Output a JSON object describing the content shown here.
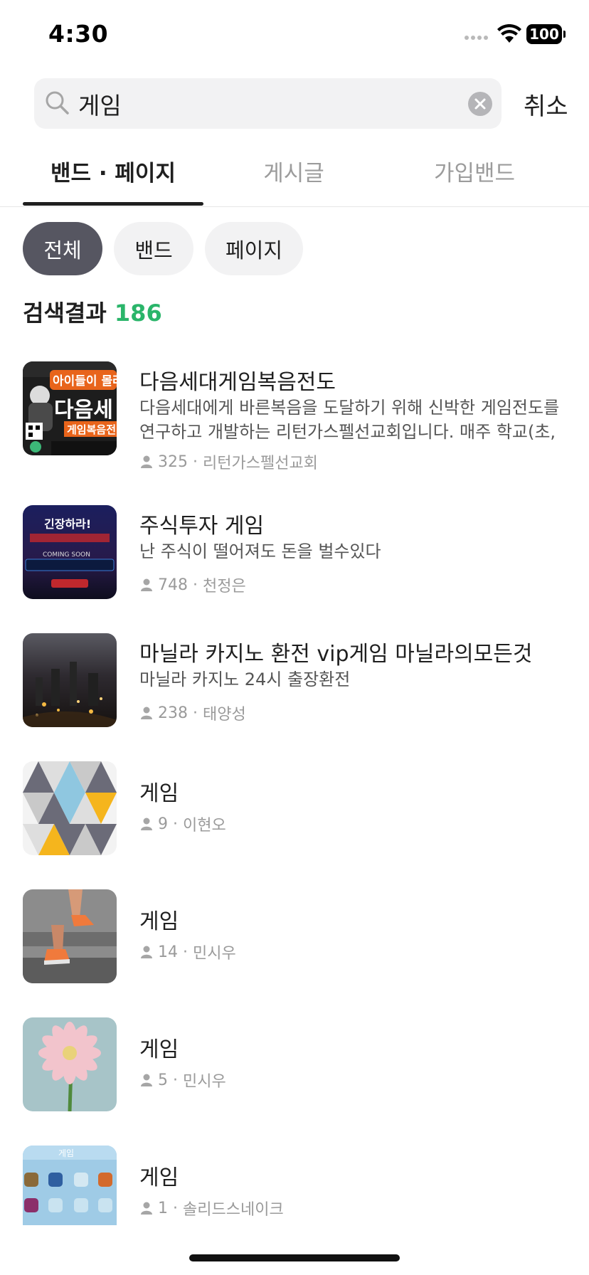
{
  "status": {
    "time": "4:30",
    "battery": "100"
  },
  "search": {
    "value": "게임",
    "cancel_label": "취소"
  },
  "tabs": [
    {
      "label": "밴드 · 페이지",
      "active": true
    },
    {
      "label": "게시글",
      "active": false
    },
    {
      "label": "가입밴드",
      "active": false
    }
  ],
  "filters": [
    {
      "label": "전체",
      "active": true
    },
    {
      "label": "밴드",
      "active": false
    },
    {
      "label": "페이지",
      "active": false
    }
  ],
  "results": {
    "header": "검색결과",
    "count": "186",
    "items": [
      {
        "title": "다음세대게임복음전도",
        "description": "다음세대에게 바른복음을 도달하기 위해 신박한 게임전도를 연구하고 개발하는 리턴가스펠선교회입니다. 매주 학교(초,",
        "members": "325",
        "leader": "리턴가스펠선교회",
        "thumb_text_1": "아이들이 몰려",
        "thumb_text_2": "다음세",
        "thumb_text_3": "게임복음전"
      },
      {
        "title": "주식투자 게임",
        "description": "난 주식이 떨어져도 돈을 벌수있다",
        "members": "748",
        "leader": "천정은",
        "thumb_text_1": "긴장하라!",
        "thumb_text_2": "COMING SOON"
      },
      {
        "title": "마닐라 카지노 환전 vip게임 마닐라의모든것",
        "description": "마닐라 카지노 24시 출장환전",
        "members": "238",
        "leader": "태양성"
      },
      {
        "title": "게임",
        "description": "",
        "members": "9",
        "leader": "이현오"
      },
      {
        "title": "게임",
        "description": "",
        "members": "14",
        "leader": "민시우"
      },
      {
        "title": "게임",
        "description": "",
        "members": "5",
        "leader": "민시우"
      },
      {
        "title": "게임",
        "description": "",
        "members": "1",
        "leader": "솔리드스네이크",
        "thumb_text_1": "게임"
      }
    ]
  },
  "colors": {
    "accent_green": "#2ab56a",
    "chip_active": "#565661",
    "chip_inactive": "#f2f2f3"
  }
}
